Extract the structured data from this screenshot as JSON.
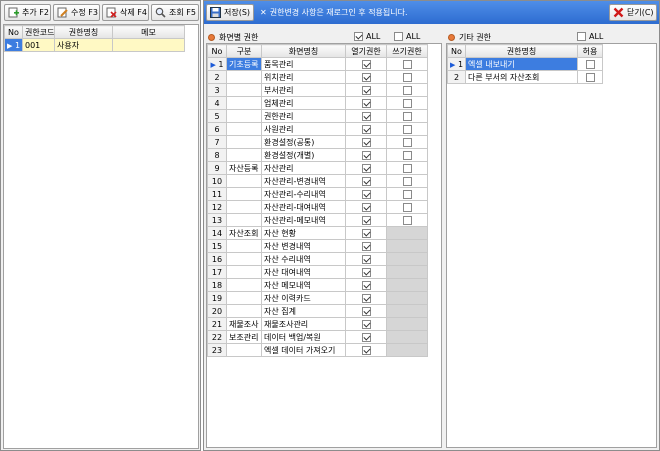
{
  "toolbar": {
    "add": "추가 F2",
    "edit": "수정 F3",
    "delete": "삭제 F4",
    "search": "조회 F5"
  },
  "left_table": {
    "headers": [
      "No",
      "권한코드",
      "권한명칭",
      "메모"
    ],
    "rows": [
      {
        "no": "1",
        "code": "001",
        "name": "사용자",
        "memo": ""
      }
    ]
  },
  "right_bar": {
    "save": "저장(S)",
    "notice": "권한변경 사항은 재로그인 후 적용됩니다.",
    "close": "닫기(C)"
  },
  "screen_perm": {
    "title": "화면별 권한",
    "all_label_1": "ALL",
    "all_label_2": "ALL",
    "headers": [
      "No",
      "구분",
      "화면명칭",
      "열기권한",
      "쓰기권한"
    ],
    "rows": [
      {
        "no": "1",
        "group": "기초등록",
        "name": "품목관리",
        "open": true,
        "write": false,
        "write_enabled": true
      },
      {
        "no": "2",
        "group": "",
        "name": "위치관리",
        "open": true,
        "write": false,
        "write_enabled": true
      },
      {
        "no": "3",
        "group": "",
        "name": "부서관리",
        "open": true,
        "write": false,
        "write_enabled": true
      },
      {
        "no": "4",
        "group": "",
        "name": "업체관리",
        "open": true,
        "write": false,
        "write_enabled": true
      },
      {
        "no": "5",
        "group": "",
        "name": "권한관리",
        "open": true,
        "write": false,
        "write_enabled": true
      },
      {
        "no": "6",
        "group": "",
        "name": "사원관리",
        "open": true,
        "write": false,
        "write_enabled": true
      },
      {
        "no": "7",
        "group": "",
        "name": "환경설정(공통)",
        "open": true,
        "write": false,
        "write_enabled": true
      },
      {
        "no": "8",
        "group": "",
        "name": "환경설정(개별)",
        "open": true,
        "write": false,
        "write_enabled": true
      },
      {
        "no": "9",
        "group": "자산등록",
        "name": "자산관리",
        "open": true,
        "write": false,
        "write_enabled": true
      },
      {
        "no": "10",
        "group": "",
        "name": "자산관리-변경내역",
        "open": true,
        "write": false,
        "write_enabled": true
      },
      {
        "no": "11",
        "group": "",
        "name": "자산관리-수리내역",
        "open": true,
        "write": false,
        "write_enabled": true
      },
      {
        "no": "12",
        "group": "",
        "name": "자산관리-대여내역",
        "open": true,
        "write": false,
        "write_enabled": true
      },
      {
        "no": "13",
        "group": "",
        "name": "자산관리-메모내역",
        "open": true,
        "write": false,
        "write_enabled": true
      },
      {
        "no": "14",
        "group": "자산조회",
        "name": "자산 현황",
        "open": true,
        "write": false,
        "write_enabled": false
      },
      {
        "no": "15",
        "group": "",
        "name": "자산 변경내역",
        "open": true,
        "write": false,
        "write_enabled": false
      },
      {
        "no": "16",
        "group": "",
        "name": "자산 수리내역",
        "open": true,
        "write": false,
        "write_enabled": false
      },
      {
        "no": "17",
        "group": "",
        "name": "자산 대여내역",
        "open": true,
        "write": false,
        "write_enabled": false
      },
      {
        "no": "18",
        "group": "",
        "name": "자산 메모내역",
        "open": true,
        "write": false,
        "write_enabled": false
      },
      {
        "no": "19",
        "group": "",
        "name": "자산 이력카드",
        "open": true,
        "write": false,
        "write_enabled": false
      },
      {
        "no": "20",
        "group": "",
        "name": "자산 집계",
        "open": true,
        "write": false,
        "write_enabled": false
      },
      {
        "no": "21",
        "group": "재물조사",
        "name": "재물조사관리",
        "open": true,
        "write": false,
        "write_enabled": false
      },
      {
        "no": "22",
        "group": "보조관리",
        "name": "데이터 백업/복원",
        "open": true,
        "write": false,
        "write_enabled": false
      },
      {
        "no": "23",
        "group": "",
        "name": "엑셀 데이터 가져오기",
        "open": true,
        "write": false,
        "write_enabled": false
      }
    ]
  },
  "other_perm": {
    "title": "기타 권한",
    "all_label": "ALL",
    "headers": [
      "No",
      "권한명칭",
      "허용"
    ],
    "rows": [
      {
        "no": "1",
        "name": "엑셀 내보내기",
        "allow": false
      },
      {
        "no": "2",
        "name": "다른 부서의 자산조회",
        "allow": false
      }
    ]
  }
}
